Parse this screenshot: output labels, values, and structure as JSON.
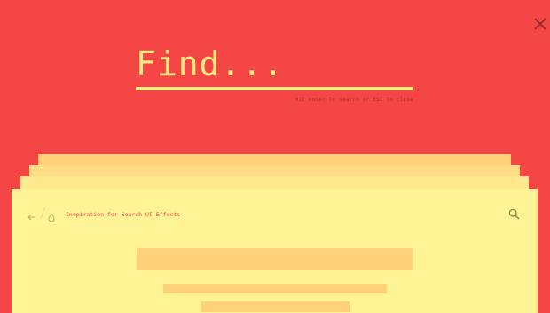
{
  "overlay": {
    "search_placeholder": "Find...",
    "search_value": "",
    "hint": "Hit enter to search or ESC to close",
    "close_icon": "close-icon"
  },
  "page": {
    "link_text": "Inspiration for Search UI Effects",
    "back_icon": "arrow-left-icon",
    "drop_icon": "drop-icon",
    "search_icon": "search-icon"
  },
  "colors": {
    "background": "#f54646",
    "accent": "#ffea7f",
    "card": "#fff495",
    "block": "#ffd27a",
    "hint": "#9e2f2f"
  }
}
